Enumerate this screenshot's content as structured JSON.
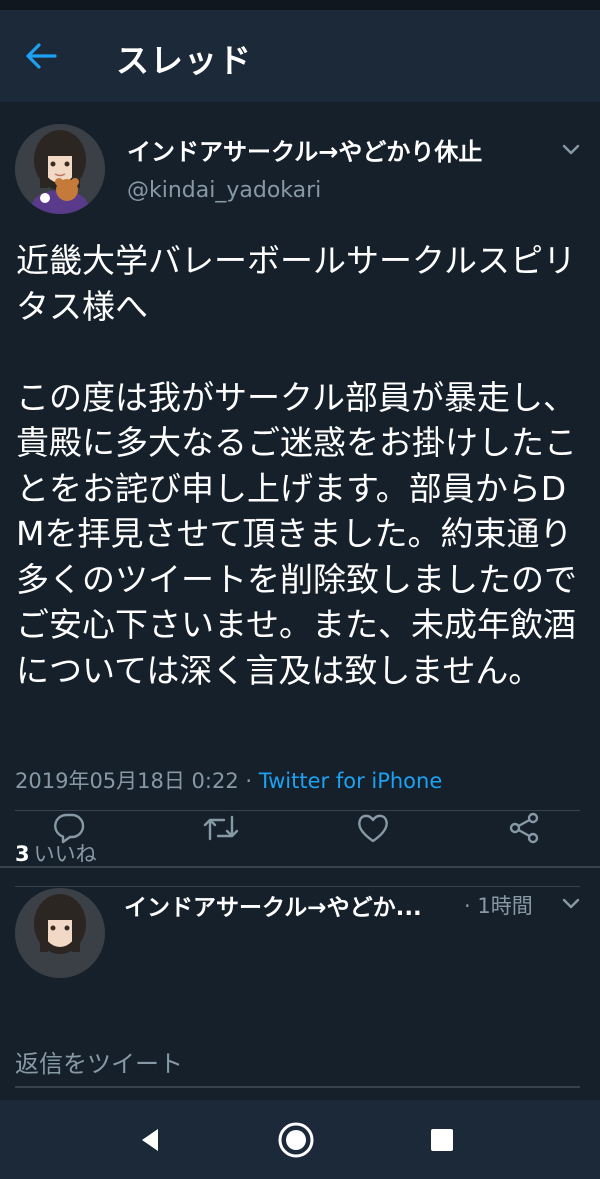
{
  "header": {
    "title": "スレッド",
    "back_icon": "arrow-left-icon",
    "accent_color": "#1da1f2"
  },
  "tweet": {
    "display_name": "インドアサークル→やどかり休止",
    "handle": "@kindai_yadokari",
    "body": "近畿大学バレーボールサークルスピリタス様へ\n\nこの度は我がサークル部員が暴走し、貴殿に多大なるご迷惑をお掛けしたことをお詫び申し上げます。部員からDMを拝見させて頂きました。約束通り多くのツイートを削除致しましたのでご安心下さいませ。また、未成年飲酒については深く言及は致しません。",
    "timestamp": "2019年05月18日 0:22",
    "separator": " · ",
    "source": "Twitter for iPhone",
    "likes_count": "3",
    "likes_label": "いいね"
  },
  "actions": {
    "reply_icon": "reply-icon",
    "retweet_icon": "retweet-icon",
    "like_icon": "heart-icon",
    "share_icon": "share-icon"
  },
  "reply_preview": {
    "display_name": "インドアサークル→やどか...",
    "time": "· 1時間"
  },
  "composer": {
    "placeholder": "返信をツイート",
    "value": ""
  },
  "system_nav": {
    "back_icon": "triangle-back-icon",
    "home_icon": "circle-home-icon",
    "recents_icon": "square-recents-icon"
  },
  "colors": {
    "background": "#15202b",
    "header": "#1c2938",
    "secondary_text": "#8899a6",
    "divider": "#38444d",
    "link": "#1da1f2"
  }
}
